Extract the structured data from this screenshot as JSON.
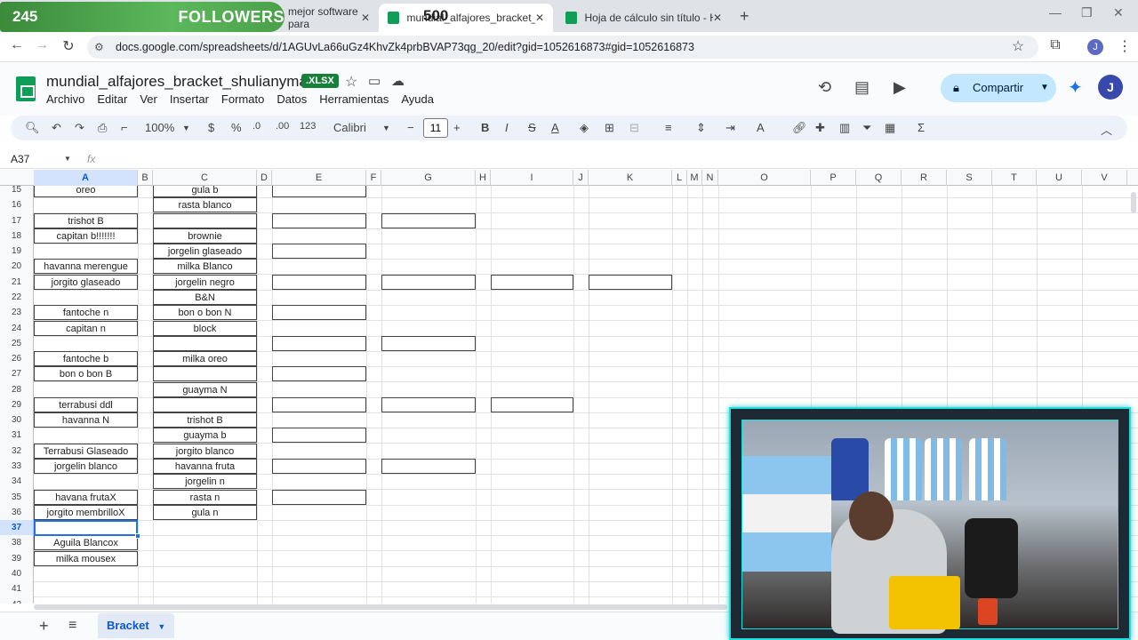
{
  "browser": {
    "tabs": [
      {
        "title": "mejor software para",
        "active": false
      },
      {
        "title": "mundial_alfajores_bracket_shul",
        "active": true
      },
      {
        "title": "Hoja de cálculo sin título - Hoja",
        "active": false
      }
    ],
    "url": "docs.google.com/spreadsheets/d/1AGUvLa66uGz4KhvZk4prbBVAP73qg_20/edit?gid=1052616873#gid=1052616873"
  },
  "overlay": {
    "count": "245",
    "label": "FOLLOWERS",
    "goal": "500"
  },
  "app": {
    "title": "mundial_alfajores_bracket_shulianymabis",
    "badge": ".XLSX",
    "menu": [
      "Archivo",
      "Editar",
      "Ver",
      "Insertar",
      "Formato",
      "Datos",
      "Herramientas",
      "Ayuda"
    ],
    "share_label": "Compartir",
    "avatar_letter": "J"
  },
  "toolbar": {
    "zoom": "100%",
    "currency": "$",
    "percent": "%",
    "dec_less": ".0",
    "dec_more": ".00",
    "number_format": "123",
    "font": "Calibri",
    "font_size": "11"
  },
  "formula_bar": {
    "cell_ref": "A37",
    "fx": "fx",
    "content": ""
  },
  "columns": [
    "A",
    "B",
    "C",
    "D",
    "E",
    "F",
    "G",
    "H",
    "I",
    "J",
    "K",
    "L",
    "M",
    "N",
    "O",
    "P",
    "Q",
    "R",
    "S",
    "T",
    "U",
    "V"
  ],
  "rows": [
    "15",
    "16",
    "17",
    "18",
    "19",
    "20",
    "21",
    "22",
    "23",
    "24",
    "25",
    "26",
    "27",
    "28",
    "29",
    "30",
    "31",
    "32",
    "33",
    "34",
    "35",
    "36",
    "37",
    "38",
    "39",
    "40",
    "41",
    "42"
  ],
  "column_a": {
    "15": "oreo",
    "17": "trishot B",
    "18": "capitan b!!!!!!!",
    "20": "havanna merengue",
    "21": "jorgito glaseado",
    "23": "fantoche n",
    "24": "capitan n",
    "26": "fantoche b",
    "27": "bon o bon B",
    "29": "terrabusi ddl",
    "30": "havanna N",
    "32": "Terrabusi Glaseado",
    "33": "jorgelin blanco",
    "35": "havana frutaX",
    "36": "jorgito membrilloX",
    "38": "Aguila Blancox",
    "39": "milka mousex"
  },
  "column_c": {
    "15": "gula b",
    "16": "rasta blanco",
    "18": "brownie",
    "19": "jorgelin glaseado",
    "20": "milka Blanco",
    "21": "jorgelin negro",
    "22": "B&N",
    "23": "bon o bon N",
    "24": "block",
    "26": "milka oreo",
    "28": "guayma N",
    "30": "trishot B",
    "31": "guayma b",
    "32": "jorgito blanco",
    "33": "havanna fruta",
    "34": "jorgelin n",
    "35": "rasta n",
    "36": "gula n"
  },
  "sheet": {
    "tab_name": "Bracket"
  }
}
